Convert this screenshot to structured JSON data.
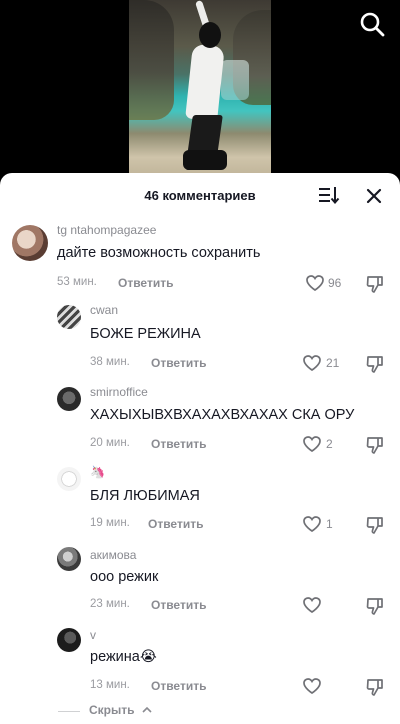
{
  "header": {
    "title": "46 комментариев"
  },
  "comments": [
    {
      "username": "tg ntahompagazee",
      "text": "дайте возможность сохранить",
      "time": "53 мин.",
      "reply": "Ответить",
      "likes": "96"
    },
    {
      "username": "cwan",
      "text": "БОЖЕ РЕЖИНА",
      "time": "38 мин.",
      "reply": "Ответить",
      "likes": "21"
    },
    {
      "username": "smirnoffice",
      "text": "ХАХЫХЫВХВХАХАХВХАХАХ СКА ОРУ",
      "time": "20 мин.",
      "reply": "Ответить",
      "likes": "2"
    },
    {
      "username": "🦄",
      "text": "БЛЯ ЛЮБИМАЯ",
      "time": "19 мин.",
      "reply": "Ответить",
      "likes": "1"
    },
    {
      "username": "акимова",
      "text": "ооо режик",
      "time": "23 мин.",
      "reply": "Ответить",
      "likes": ""
    },
    {
      "username": "v",
      "text": "режина😭",
      "time": "13 мин.",
      "reply": "Ответить",
      "likes": ""
    }
  ],
  "footer": {
    "hide_label": "Скрыть"
  },
  "icons": {
    "search": "search-icon",
    "sort": "sort-icon",
    "close": "close-icon",
    "like": "heart-outline-icon",
    "dislike": "dislike-icon",
    "hide_chevron": "chevron-up-icon"
  },
  "colors": {
    "text": "#161823",
    "secondary": "#8a8b91",
    "sheet": "#ffffff",
    "backdrop": "#000000"
  }
}
